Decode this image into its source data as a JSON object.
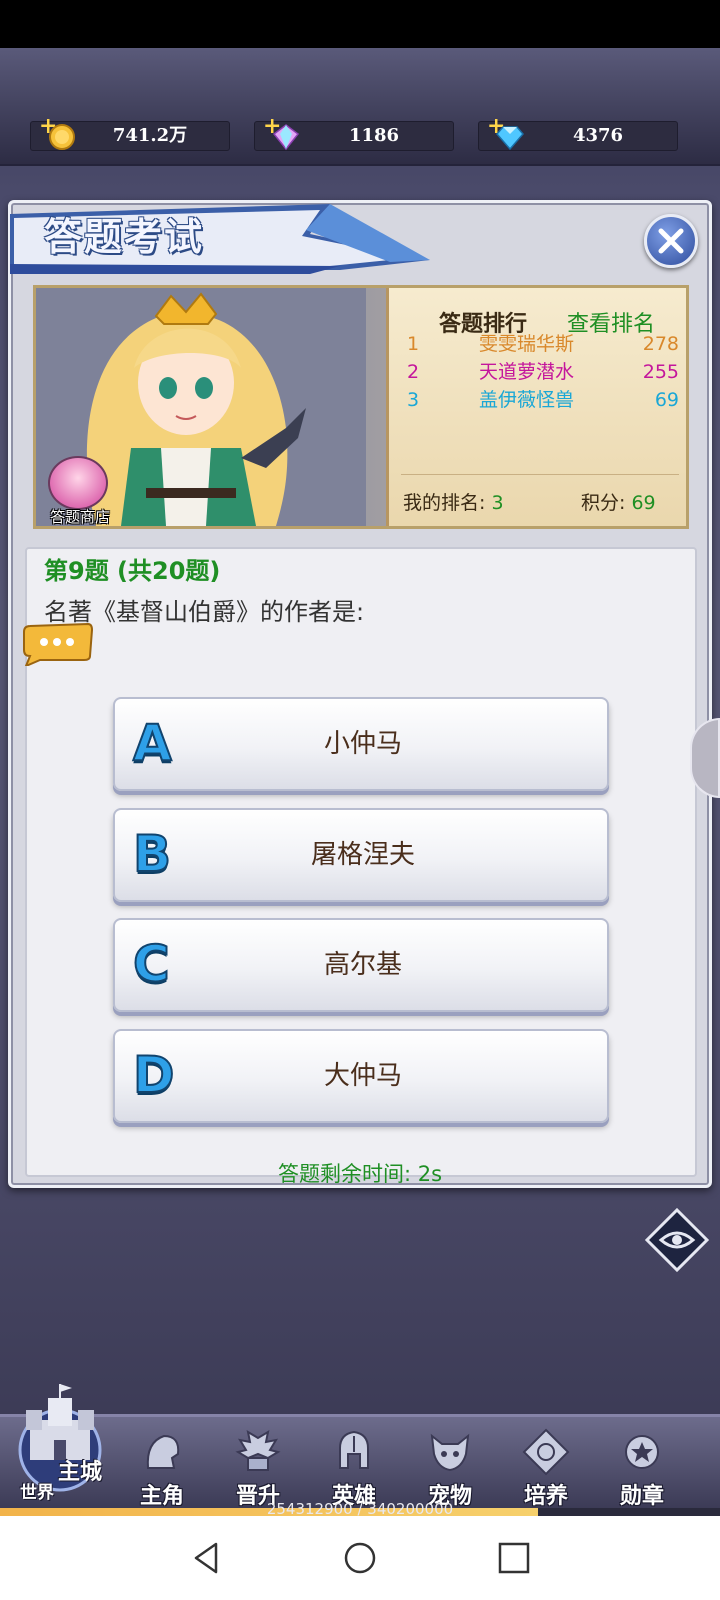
{
  "resources": [
    {
      "name": "gold",
      "value": "741.2万",
      "color": "#f6c23a"
    },
    {
      "name": "crystal",
      "value": "1186",
      "color": "#d58cf2"
    },
    {
      "name": "diamond",
      "value": "4376",
      "color": "#4fc7ff"
    }
  ],
  "dialog": {
    "title": "答题考试",
    "close_icon": "close-icon"
  },
  "leaderboard": {
    "title": "答题排行",
    "view_link": "查看排名",
    "rows": [
      {
        "rank": "1",
        "name": "雯雯瑞华斯",
        "score": "278",
        "color": "#d9882b"
      },
      {
        "rank": "2",
        "name": "天道萝潜水",
        "score": "255",
        "color": "#c4169c"
      },
      {
        "rank": "3",
        "name": "盖伊薇怪兽",
        "score": "69",
        "color": "#1aa7d6"
      }
    ],
    "my_rank_label": "我的排名:",
    "my_rank_value": "3",
    "score_label": "积分:",
    "score_value": "69"
  },
  "shop": {
    "label": "答题商店"
  },
  "question": {
    "number_text": "第9题 (共20题)",
    "text": "名著《基督山伯爵》的作者是:",
    "options": [
      {
        "letter": "A",
        "text": "小仲马"
      },
      {
        "letter": "B",
        "text": "屠格涅夫"
      },
      {
        "letter": "C",
        "text": "高尔基"
      },
      {
        "letter": "D",
        "text": "大仲马"
      }
    ],
    "timer_text": "答题剩余时间:  2s"
  },
  "bottom_nav": {
    "city_main": "主城",
    "city_world": "世界",
    "items": [
      {
        "label": "主角",
        "icon": "hero-head-icon"
      },
      {
        "label": "晋升",
        "icon": "book-wings-icon"
      },
      {
        "label": "英雄",
        "icon": "helmet-icon"
      },
      {
        "label": "宠物",
        "icon": "beast-icon"
      },
      {
        "label": "培养",
        "icon": "emblem-icon"
      },
      {
        "label": "勋章",
        "icon": "medal-icon"
      }
    ]
  },
  "exp": {
    "text": "254312900 / 340200000",
    "progress": 0.7476
  }
}
